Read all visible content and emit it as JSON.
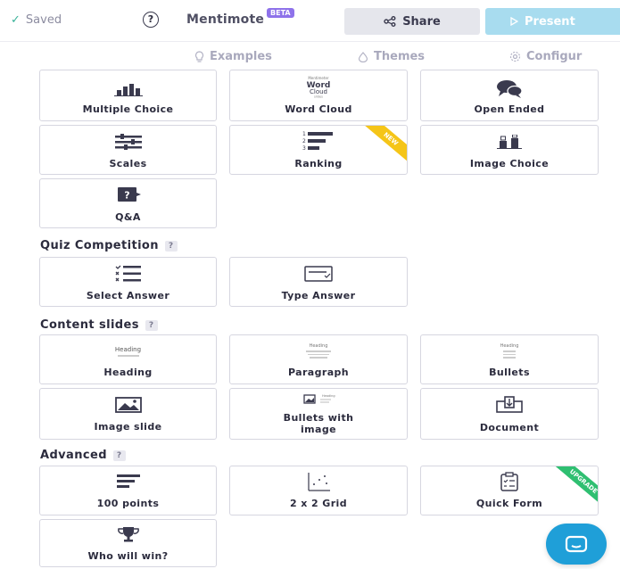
{
  "topbar": {
    "saved": "Saved",
    "brand": "Mentimote",
    "beta": "BETA",
    "share": "Share",
    "present": "Present"
  },
  "tabs": [
    {
      "label": "Examples",
      "icon": "bulb-icon"
    },
    {
      "label": "Themes",
      "icon": "drop-icon"
    },
    {
      "label": "Configur",
      "icon": "gear-icon"
    }
  ],
  "question_types": {
    "items": [
      {
        "label": "Multiple Choice",
        "icon": "bar-chart-icon"
      },
      {
        "label": "Word Cloud",
        "icon": "word-cloud-icon"
      },
      {
        "label": "Open Ended",
        "icon": "speech-bubbles-icon"
      },
      {
        "label": "Scales",
        "icon": "sliders-icon"
      },
      {
        "label": "Ranking",
        "icon": "ranking-icon",
        "badge": "NEW"
      },
      {
        "label": "Image Choice",
        "icon": "image-bars-icon"
      },
      {
        "label": "Q&A",
        "icon": "question-bubble-icon"
      }
    ]
  },
  "quiz": {
    "title": "Quiz Competition",
    "help": "?",
    "items": [
      {
        "label": "Select Answer",
        "icon": "checklist-icon"
      },
      {
        "label": "Type Answer",
        "icon": "text-input-icon"
      }
    ]
  },
  "content": {
    "title": "Content slides",
    "help": "?",
    "items": [
      {
        "label": "Heading",
        "icon": "heading-thumb-icon",
        "thumb": "Heading"
      },
      {
        "label": "Paragraph",
        "icon": "paragraph-thumb-icon",
        "thumb": "Heading"
      },
      {
        "label": "Bullets",
        "icon": "bullets-thumb-icon",
        "thumb": "Heading"
      },
      {
        "label": "Image slide",
        "icon": "image-icon"
      },
      {
        "label": "Bullets with image",
        "icon": "bullets-image-icon",
        "thumb": "Heading"
      },
      {
        "label": "Document",
        "icon": "document-icon"
      }
    ]
  },
  "advanced": {
    "title": "Advanced",
    "help": "?",
    "items": [
      {
        "label": "100 points",
        "icon": "lines-icon"
      },
      {
        "label": "2 x 2 Grid",
        "icon": "scatter-grid-icon"
      },
      {
        "label": "Quick Form",
        "icon": "clipboard-icon",
        "badge": "UPGRADE"
      },
      {
        "label": "Who will win?",
        "icon": "trophy-icon"
      }
    ]
  },
  "colors": {
    "present": "#a8dcef",
    "beta": "#8e72ea",
    "new_ribbon": "#f5c518",
    "upgrade_ribbon": "#2fbf71",
    "chat": "#1f9fd8"
  }
}
